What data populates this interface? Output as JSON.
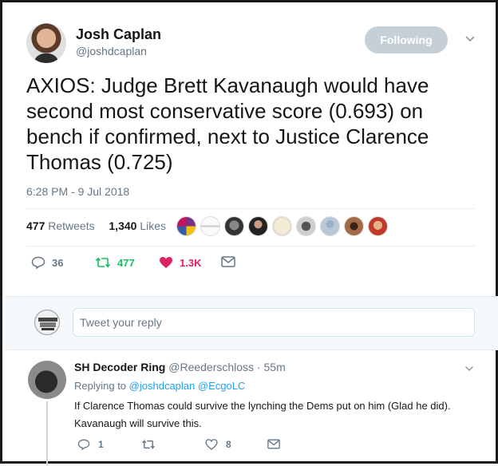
{
  "tweet": {
    "author_name": "Josh Caplan",
    "author_handle": "@joshdcaplan",
    "follow_label": "Following",
    "text": "AXIOS: Judge Brett Kavanaugh would have second most conservative score (0.693) on bench if confirmed, next to Justice Clarence Thomas (0.725)",
    "timestamp": "6:28 PM - 9 Jul 2018",
    "retweets_count": "477",
    "retweets_label": "Retweets",
    "likes_count": "1,340",
    "likes_label": "Likes",
    "actions": {
      "replies": "36",
      "retweets": "477",
      "likes": "1.3K"
    },
    "colors": {
      "retweet": "#17bf63",
      "like": "#e0245e",
      "link": "#1da1f2",
      "follow_bg": "#c4cfd6"
    }
  },
  "reply_box": {
    "placeholder": "Tweet your reply"
  },
  "reply": {
    "name": "SH Decoder Ring",
    "handle": "@Reederschloss",
    "time": "· 55m",
    "replying_to_label": "Replying to",
    "replying_to_users": "@joshdcaplan @EcgoLC",
    "text": "If Clarence Thomas could survive the lynching the Dems put on him (Glad he did). Kavanaugh will survive this.",
    "actions": {
      "replies": "1",
      "likes": "8"
    }
  }
}
